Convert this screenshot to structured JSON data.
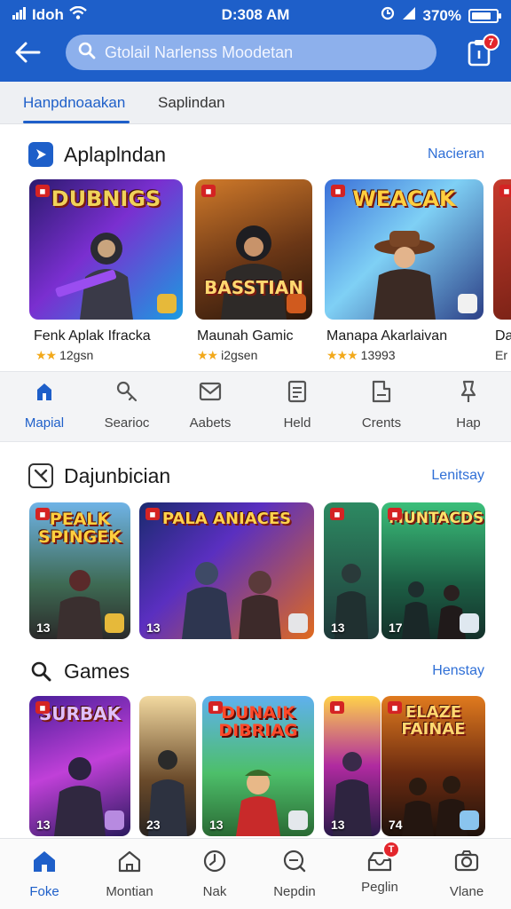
{
  "status_bar": {
    "carrier": "Idoh",
    "time": "D:308 AM",
    "battery": "370%",
    "battery_level": 0.8
  },
  "header": {
    "search_placeholder": "Gtolail Narlenss Moodetan",
    "inbox_badge": "7"
  },
  "tabs": [
    {
      "label": "Hanpdnoaakan",
      "active": true
    },
    {
      "label": "Saplindan",
      "active": false
    }
  ],
  "section1": {
    "title": "Aplaplndan",
    "more": "Nacieran",
    "cards": [
      {
        "art": "DUBNIGS",
        "label": "Fenk Aplak Ifracka",
        "rating": "12gsn",
        "stars": "★★"
      },
      {
        "art": "BASSTIAN",
        "label": "Maunah Gamic",
        "rating": "i2gsen",
        "stars": "★★"
      },
      {
        "art": "WEACAK",
        "label": "Manapa Akarlaivan",
        "rating": "13993",
        "stars": "★★★"
      },
      {
        "art": "",
        "label": "Da",
        "rating": "Er",
        "stars": ""
      }
    ]
  },
  "categories": [
    {
      "label": "Mapial",
      "icon": "home-shield-icon",
      "active": true
    },
    {
      "label": "Searioc",
      "icon": "key-icon",
      "active": false
    },
    {
      "label": "Aabets",
      "icon": "mail-icon",
      "active": false
    },
    {
      "label": "Held",
      "icon": "document-icon",
      "active": false
    },
    {
      "label": "Crents",
      "icon": "tag-icon",
      "active": false
    },
    {
      "label": "Hap",
      "icon": "pin-icon",
      "active": false
    }
  ],
  "section2": {
    "title": "Dajunbician",
    "more": "Lenitsay",
    "cards": [
      {
        "art": "PEALK SPINGEK",
        "num": "13"
      },
      {
        "art": "PALA ANIACES",
        "num": "13"
      },
      {
        "art": "",
        "num": "13"
      },
      {
        "art": "",
        "num": "13"
      },
      {
        "art": "MUNTACDS",
        "num": "17"
      }
    ]
  },
  "section3": {
    "title": "Games",
    "more": "Henstay",
    "cards": [
      {
        "art": "SURBAK",
        "num": "13"
      },
      {
        "art": "",
        "num": "23"
      },
      {
        "art": "DUNAIK DIBRIAG",
        "num": "13"
      },
      {
        "art": "",
        "num": "13"
      },
      {
        "art": "ELAZE FAINAE",
        "num": "74"
      }
    ]
  },
  "bottom_nav": [
    {
      "label": "Foke",
      "icon": "home-icon",
      "active": true
    },
    {
      "label": "Montian",
      "icon": "house-outline-icon",
      "active": false
    },
    {
      "label": "Nak",
      "icon": "clock-icon",
      "active": false
    },
    {
      "label": "Nepdin",
      "icon": "chat-icon",
      "active": false
    },
    {
      "label": "Peglin",
      "icon": "inbox-icon",
      "active": false,
      "badge": "T"
    },
    {
      "label": "Vlane",
      "icon": "camera-icon",
      "active": false
    }
  ]
}
